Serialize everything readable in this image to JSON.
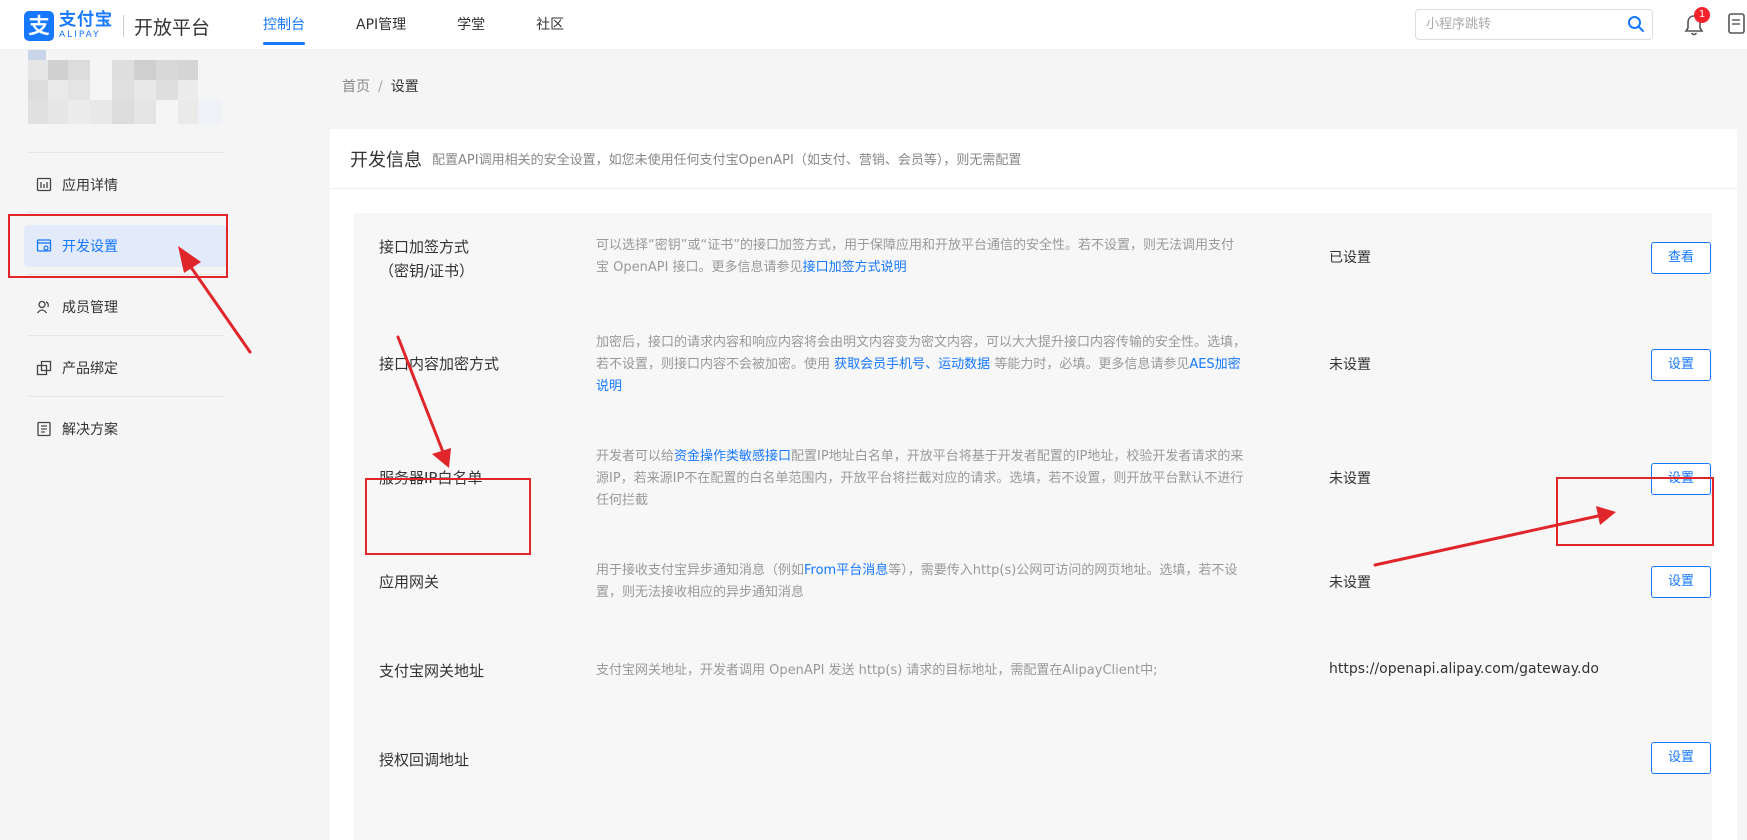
{
  "header": {
    "logo_cn": "支付宝",
    "logo_en": "ALIPAY",
    "logo_glyph": "支",
    "platform": "开放平台",
    "nav": [
      {
        "label": "控制台",
        "active": true
      },
      {
        "label": "API管理",
        "active": false
      },
      {
        "label": "学堂",
        "active": false
      },
      {
        "label": "社区",
        "active": false
      }
    ],
    "search_placeholder": "小程序跳转",
    "notification_count": "1"
  },
  "sidebar": {
    "items": [
      {
        "label": "应用详情",
        "icon": "app-detail-icon"
      },
      {
        "label": "开发设置",
        "icon": "dev-settings-icon",
        "active": true
      },
      {
        "label": "成员管理",
        "icon": "members-icon"
      },
      {
        "label": "产品绑定",
        "icon": "product-binding-icon"
      },
      {
        "label": "解决方案",
        "icon": "solutions-icon"
      }
    ]
  },
  "breadcrumb": {
    "home": "首页",
    "separator": "/",
    "current": "设置"
  },
  "dev_info": {
    "title": "开发信息",
    "description": "配置API调用相关的安全设置，如您未使用任何支付宝OpenAPI（如支付、营销、会员等），则无需配置",
    "rows": [
      {
        "name_line1": "接口加签方式",
        "name_line2": "（密钥/证书）",
        "desc_parts": [
          "可以选择“密钥”或“证书”的接口加签方式，用于保障应用和开放平台通信的安全性。若不设置，则无法调用支付宝 OpenAPI 接口。更多信息请参见",
          "接口加签方式说明"
        ],
        "status": "已设置",
        "button": "查看"
      },
      {
        "name_line1": "接口内容加密方式",
        "desc_parts": [
          "加密后，接口的请求内容和响应内容将会由明文内容变为密文内容，可以大大提升接口内容传输的安全性。选填，若不设置，则接口内容不会被加密。使用 ",
          "获取会员手机号",
          "、",
          "运动数据",
          " 等能力时，必填。更多信息请参见",
          "AES加密说明"
        ],
        "status": "未设置",
        "button": "设置"
      },
      {
        "name_line1": "服务器IP白名单",
        "desc_parts": [
          "开发者可以给",
          "资金操作类敏感接口",
          "配置IP地址白名单，开放平台将基于开发者配置的IP地址，校验开发者请求的来源IP，若来源IP不在配置的白名单范围内，开放平台将拦截对应的请求。选填，若不设置，则开放平台默认不进行任何拦截"
        ],
        "status": "未设置",
        "button": "设置"
      },
      {
        "name_line1": "应用网关",
        "desc_parts": [
          "用于接收支付宝异步通知消息（例如",
          "From平台消息",
          "等），需要传入http(s)公网可访问的网页地址。选填，若不设置，则无法接收相应的异步通知消息"
        ],
        "status": "未设置",
        "button": "设置"
      },
      {
        "name_line1": "支付宝网关地址",
        "desc_parts": [
          "支付宝网关地址，开发者调用 OpenAPI 发送 http(s) 请求的目标地址，需配置在AlipayClient中;"
        ],
        "status": "https://openapi.alipay.com/gateway.do"
      },
      {
        "name_line1": "授权回调地址",
        "button": "设置"
      }
    ]
  },
  "colors": {
    "accent": "#1677ff",
    "annotation": "#e0262b"
  }
}
